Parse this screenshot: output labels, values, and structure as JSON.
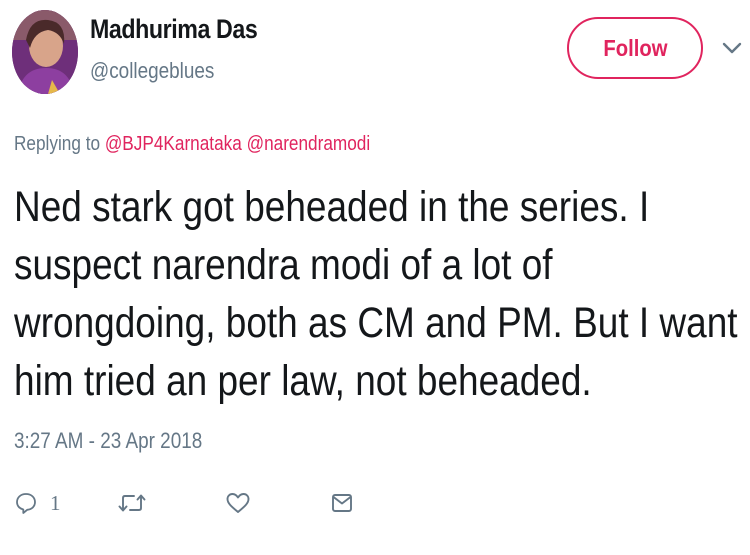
{
  "user": {
    "display_name": "Madhurima Das",
    "handle": "@collegeblues",
    "avatar_icon": "profile-photo"
  },
  "follow_button": {
    "label": "Follow"
  },
  "menu_caret_icon": "chevron-down-icon",
  "reply_context": {
    "prefix": "Replying to ",
    "mentions": [
      "@BJP4Karnataka",
      "@narendramodi"
    ]
  },
  "tweet": {
    "text": "Ned stark got beheaded in the series. I\nsuspect narendra modi of a lot of\nwrongdoing, both as CM and PM.  But I want\nhim tried an per law, not beheaded.",
    "timestamp": "3:27 AM - 23 Apr 2018"
  },
  "actions": {
    "reply": {
      "icon": "reply-icon",
      "count": "1"
    },
    "retweet": {
      "icon": "retweet-icon"
    },
    "like": {
      "icon": "heart-icon"
    },
    "message": {
      "icon": "envelope-icon"
    }
  },
  "colors": {
    "accent": "#e0245e",
    "secondary_text": "#657786",
    "primary_text": "#14171a"
  }
}
